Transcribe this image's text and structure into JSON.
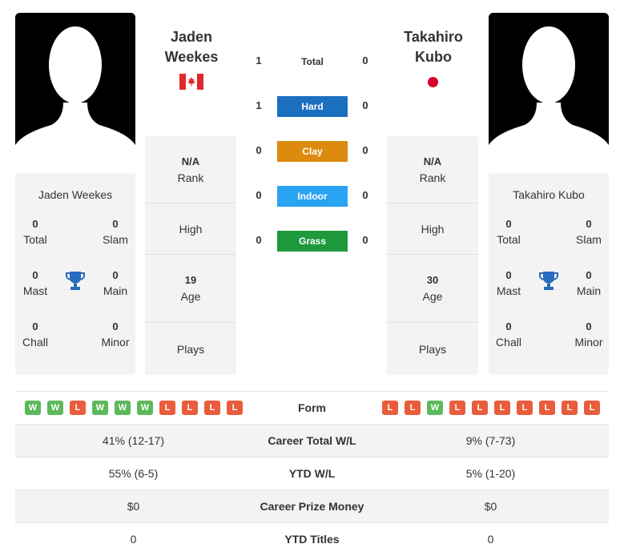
{
  "colors": {
    "hard": "#1b6fbf",
    "clay": "#dd8b0f",
    "indoor": "#2aa3f3",
    "grass": "#1e9a3d",
    "win": "#5cb85c",
    "loss": "#e95d3c"
  },
  "player1": {
    "name": "Jaden Weekes",
    "title_line1": "Jaden",
    "title_line2": "Weekes",
    "country": "Canada",
    "stats": {
      "total": "0",
      "total_label": "Total",
      "slam": "0",
      "slam_label": "Slam",
      "mast": "0",
      "mast_label": "Mast",
      "main": "0",
      "main_label": "Main",
      "chall": "0",
      "chall_label": "Chall",
      "minor": "0",
      "minor_label": "Minor"
    },
    "info": {
      "rank_value": "N/A",
      "rank_label": "Rank",
      "high_label": "High",
      "age_value": "19",
      "age_label": "Age",
      "plays_label": "Plays"
    },
    "form": [
      "W",
      "W",
      "L",
      "W",
      "W",
      "W",
      "L",
      "L",
      "L",
      "L"
    ]
  },
  "player2": {
    "name": "Takahiro Kubo",
    "title_line1": "Takahiro",
    "title_line2": "Kubo",
    "country": "Japan",
    "stats": {
      "total": "0",
      "total_label": "Total",
      "slam": "0",
      "slam_label": "Slam",
      "mast": "0",
      "mast_label": "Mast",
      "main": "0",
      "main_label": "Main",
      "chall": "0",
      "chall_label": "Chall",
      "minor": "0",
      "minor_label": "Minor"
    },
    "info": {
      "rank_value": "N/A",
      "rank_label": "Rank",
      "high_label": "High",
      "age_value": "30",
      "age_label": "Age",
      "plays_label": "Plays"
    },
    "form": [
      "L",
      "L",
      "W",
      "L",
      "L",
      "L",
      "L",
      "L",
      "L",
      "L"
    ]
  },
  "h2h": [
    {
      "label": "Total",
      "p1": "1",
      "p2": "0",
      "key": "total"
    },
    {
      "label": "Hard",
      "p1": "1",
      "p2": "0",
      "key": "hard"
    },
    {
      "label": "Clay",
      "p1": "0",
      "p2": "0",
      "key": "clay"
    },
    {
      "label": "Indoor",
      "p1": "0",
      "p2": "0",
      "key": "indoor"
    },
    {
      "label": "Grass",
      "p1": "0",
      "p2": "0",
      "key": "grass"
    }
  ],
  "comparison": {
    "form_label": "Form",
    "rows": [
      {
        "label": "Career Total W/L",
        "p1": "41% (12-17)",
        "p2": "9% (7-73)"
      },
      {
        "label": "YTD W/L",
        "p1": "55% (6-5)",
        "p2": "5% (1-20)"
      },
      {
        "label": "Career Prize Money",
        "p1": "$0",
        "p2": "$0"
      },
      {
        "label": "YTD Titles",
        "p1": "0",
        "p2": "0"
      }
    ]
  }
}
